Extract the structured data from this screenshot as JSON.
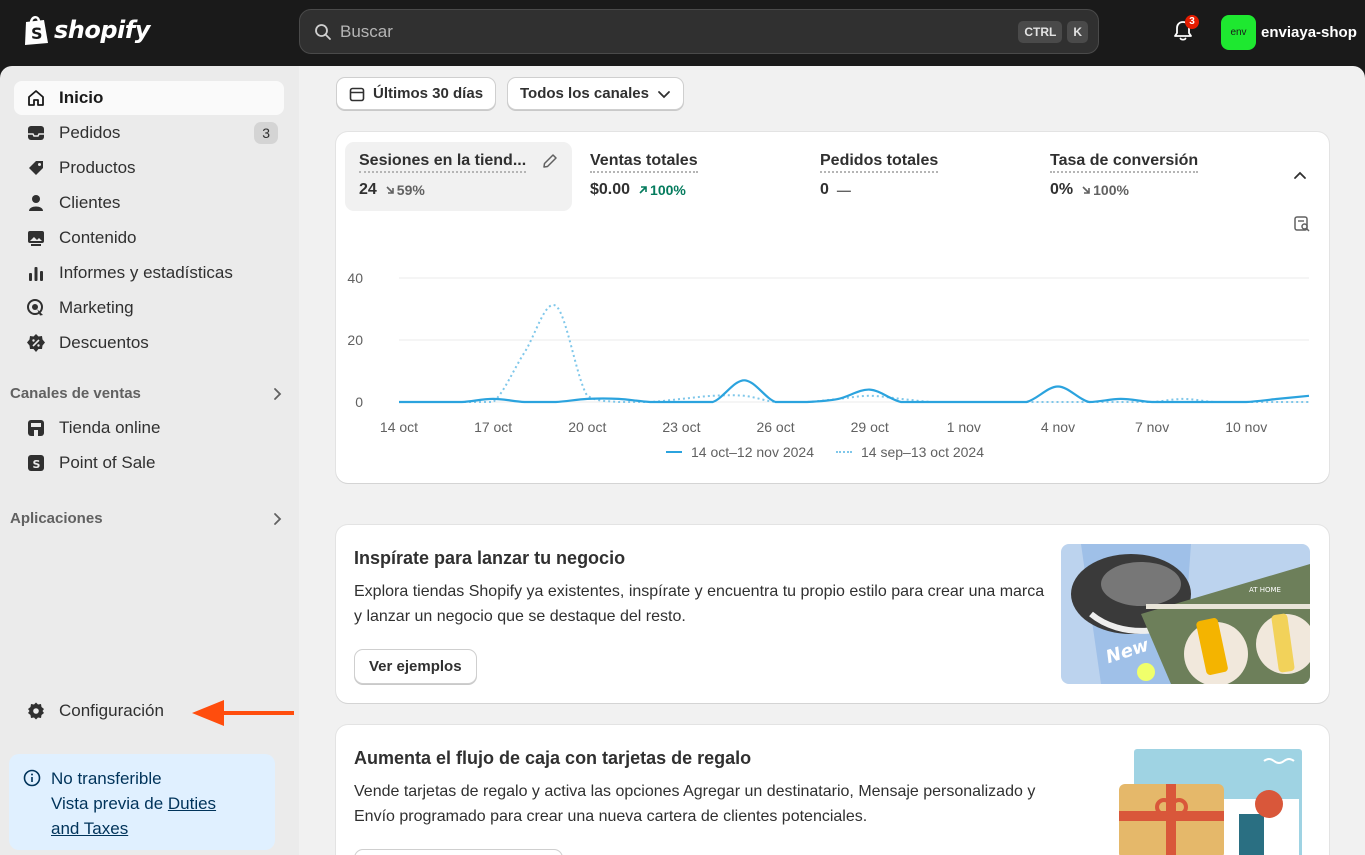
{
  "topbar": {
    "logo_text": "shopify",
    "search_placeholder": "Buscar",
    "kbd1": "CTRL",
    "kbd2": "K",
    "notifications_count": "3",
    "store_avatar": "env",
    "store_name": "enviaya-shop"
  },
  "sidebar": {
    "items": [
      {
        "label": "Inicio",
        "icon": "home-icon"
      },
      {
        "label": "Pedidos",
        "icon": "inbox-icon",
        "badge": "3"
      },
      {
        "label": "Productos",
        "icon": "tag-icon"
      },
      {
        "label": "Clientes",
        "icon": "person-icon"
      },
      {
        "label": "Contenido",
        "icon": "image-icon"
      },
      {
        "label": "Informes y estadísticas",
        "icon": "bar-chart-icon"
      },
      {
        "label": "Marketing",
        "icon": "target-icon"
      },
      {
        "label": "Descuentos",
        "icon": "discount-icon"
      }
    ],
    "sales_channels_heading": "Canales de ventas",
    "channels": [
      {
        "label": "Tienda online",
        "icon": "store-icon"
      },
      {
        "label": "Point of Sale",
        "icon": "pos-icon"
      }
    ],
    "apps_heading": "Aplicaciones",
    "settings_label": "Configuración",
    "notice": {
      "line1": "No transferible",
      "line2": "Vista previa de ",
      "link1": "Duties",
      "link2": "and Taxes"
    }
  },
  "filters": {
    "date_range": "Últimos 30 días",
    "channels": "Todos los canales"
  },
  "metrics": [
    {
      "label": "Sesiones en la tiend...",
      "value": "24",
      "change": "59%",
      "trend": "down"
    },
    {
      "label": "Ventas totales",
      "value": "$0.00",
      "change": "100%",
      "trend": "up"
    },
    {
      "label": "Pedidos totales",
      "value": "0",
      "change": "—",
      "trend": "none"
    },
    {
      "label": "Tasa de conversión",
      "value": "0%",
      "change": "100%",
      "trend": "down"
    }
  ],
  "chart_data": {
    "type": "line",
    "x": [
      "14 oct",
      "15 oct",
      "16 oct",
      "17 oct",
      "18 oct",
      "19 oct",
      "20 oct",
      "21 oct",
      "22 oct",
      "23 oct",
      "24 oct",
      "25 oct",
      "26 oct",
      "27 oct",
      "28 oct",
      "29 oct",
      "30 oct",
      "31 oct",
      "1 nov",
      "2 nov",
      "3 nov",
      "4 nov",
      "5 nov",
      "6 nov",
      "7 nov",
      "8 nov",
      "9 nov",
      "10 nov",
      "11 nov",
      "12 nov"
    ],
    "tick_labels": [
      "14 oct",
      "17 oct",
      "20 oct",
      "23 oct",
      "26 oct",
      "29 oct",
      "1 nov",
      "4 nov",
      "7 nov",
      "10 nov"
    ],
    "yticks": [
      0,
      20,
      40
    ],
    "ylim": [
      0,
      40
    ],
    "series": [
      {
        "name": "14 oct–12 nov 2024",
        "style": "solid",
        "color": "#2ba3de",
        "values": [
          0,
          0,
          0,
          1,
          0,
          0,
          1,
          1,
          0,
          0,
          0,
          7,
          0,
          0,
          1,
          4,
          0,
          0,
          0,
          0,
          0,
          5,
          0,
          1,
          0,
          0,
          0,
          0,
          1,
          2
        ]
      },
      {
        "name": "14 sep–13 oct 2024",
        "style": "dotted",
        "color": "#7fc7ea",
        "values": [
          0,
          0,
          0,
          0,
          16,
          31,
          2,
          0,
          0,
          1,
          2,
          2,
          0,
          0,
          1,
          2,
          1,
          0,
          0,
          0,
          0,
          0,
          0,
          0,
          0,
          1,
          0,
          0,
          0,
          0
        ]
      }
    ],
    "grid": true,
    "legend": "bottom-center"
  },
  "promo1": {
    "title": "Inspírate para lanzar tu negocio",
    "desc": "Explora tiendas Shopify ya existentes, inspírate y encuentra tu propio estilo para crear una marca y lanzar un negocio que se destaque del resto.",
    "button": "Ver ejemplos",
    "image_badge": "New",
    "image_heading": "AT HOME"
  },
  "promo2": {
    "title": "Aumenta el flujo de caja con tarjetas de regalo",
    "desc": "Vende tarjetas de regalo y activa las opciones Agregar un destinatario, Mensaje personalizado y Envío programado para crear una nueva cartera de clientes potenciales."
  }
}
